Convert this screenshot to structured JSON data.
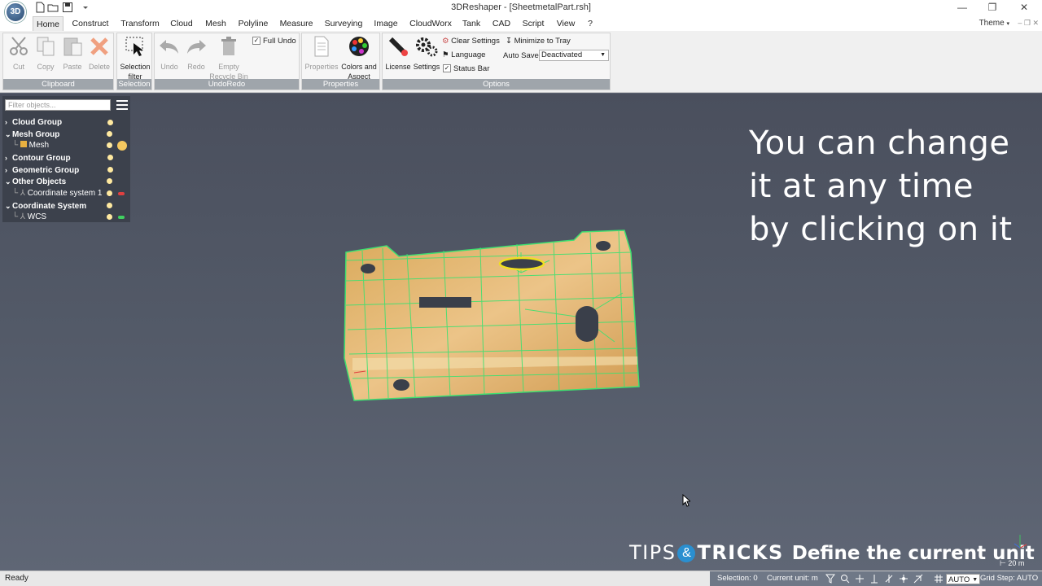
{
  "app": {
    "window_title": "3DReshaper - [SheetmetalPart.rsh]",
    "logo_text": "3D"
  },
  "tabs": [
    "Home",
    "Construct",
    "Transform",
    "Cloud",
    "Mesh",
    "Polyline",
    "Measure",
    "Surveying",
    "Image",
    "CloudWorx",
    "Tank",
    "CAD",
    "Script",
    "View",
    "?"
  ],
  "theme_label": "Theme",
  "ribbon": {
    "clipboard": {
      "title": "Clipboard",
      "cut": "Cut",
      "copy": "Copy",
      "paste": "Paste",
      "delete": "Delete"
    },
    "selection": {
      "title": "Selection",
      "filter_line1": "Selection",
      "filter_line2": "filter"
    },
    "undoredo": {
      "title": "UndoRedo",
      "undo": "Undo",
      "redo": "Redo",
      "empty_line1": "Empty",
      "empty_line2": "Recycle Bin",
      "full_undo": "Full Undo"
    },
    "properties": {
      "title": "Properties",
      "properties": "Properties",
      "colors_line1": "Colors and",
      "colors_line2": "Aspect"
    },
    "options": {
      "title": "Options",
      "license": "License",
      "settings": "Settings",
      "clear_settings": "Clear Settings",
      "language": "Language",
      "status_bar": "Status Bar",
      "minimize_to_tray": "Minimize to Tray",
      "auto_save_label": "Auto Save",
      "auto_save_value": "Deactivated"
    }
  },
  "tree": {
    "filter_placeholder": "Filter objects...",
    "items": [
      {
        "label": "Cloud Group"
      },
      {
        "label": "Mesh Group"
      },
      {
        "label": "Mesh"
      },
      {
        "label": "Contour Group"
      },
      {
        "label": "Geometric Group"
      },
      {
        "label": "Other Objects"
      },
      {
        "label": "Coordinate system 1"
      },
      {
        "label": "Coordinate System"
      },
      {
        "label": "WCS"
      }
    ]
  },
  "overlay": {
    "line1": "You can change",
    "line2": "it at any time",
    "line3": "by clicking on it"
  },
  "banner": {
    "tips": "TIPS",
    "amp": "&",
    "tricks": "TRICKS",
    "text": "Define the current unit"
  },
  "scale_label": "20 m",
  "statusbar": {
    "ready": "Ready",
    "selection": "Selection: 0",
    "current_unit": "Current unit: m",
    "auto": "AUTO",
    "grid_step": "Grid Step: AUTO"
  },
  "colors": {
    "mesh_fill": "#d9a95a",
    "mesh_wire": "#3ee070",
    "selected_edge": "#f0e020"
  }
}
